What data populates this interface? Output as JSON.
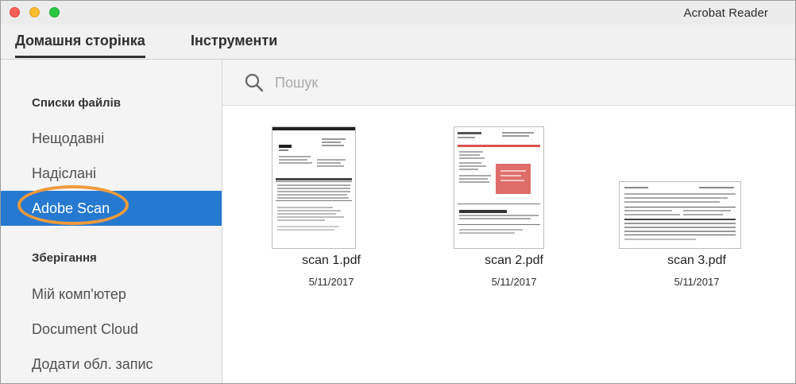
{
  "window": {
    "app_title": "Acrobat Reader"
  },
  "tabs": [
    {
      "label": "Домашня сторінка",
      "active": true
    },
    {
      "label": "Інструменти",
      "active": false
    }
  ],
  "sidebar": {
    "file_lists_heading": "Списки файлів",
    "file_list_items": [
      {
        "label": "Нещодавні",
        "selected": false
      },
      {
        "label": "Надіслані",
        "selected": false
      },
      {
        "label": "Adobe Scan",
        "selected": true
      }
    ],
    "storage_heading": "Зберігання",
    "storage_items": [
      {
        "label": "Мій комп'ютер"
      },
      {
        "label": "Document Cloud"
      },
      {
        "label": "Додати обл. запис"
      }
    ]
  },
  "search": {
    "placeholder": "Пошук",
    "value": ""
  },
  "files": [
    {
      "name": "scan 1.pdf",
      "date": "5/11/2017"
    },
    {
      "name": "scan 2.pdf",
      "date": "5/11/2017"
    },
    {
      "name": "scan 3.pdf",
      "date": "5/11/2017"
    }
  ],
  "colors": {
    "selection": "#2679d0",
    "highlight_ring": "#f09a3d",
    "stamp_red": "#d9534f"
  }
}
